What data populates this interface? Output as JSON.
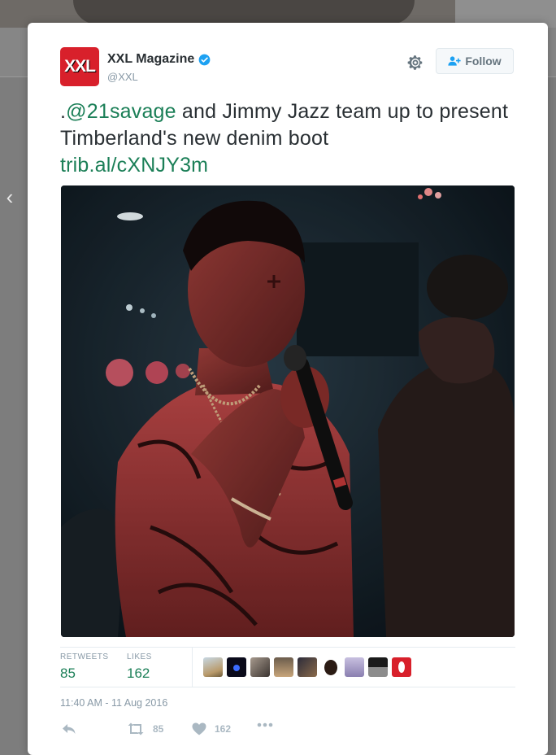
{
  "tweet": {
    "author_name": "XXL Magazine",
    "author_handle": "@XXL",
    "avatar_text": "XXL",
    "follow_label": "Follow",
    "text_prefix": ".",
    "mention": "@21savage",
    "text_body": " and Jimmy Jazz team up to present Timberland's new denim boot",
    "link": "trib.al/cXNJY3m",
    "retweets_label": "RETWEETS",
    "retweets_count": "85",
    "likes_label": "LIKES",
    "likes_count": "162",
    "timestamp": "11:40 AM - 11 Aug 2016",
    "action_retweet_count": "85",
    "action_like_count": "162"
  },
  "icons": {
    "verified": "verified-badge-icon",
    "settings": "gear-icon",
    "follow": "add-user-icon",
    "reply": "reply-icon",
    "retweet": "retweet-icon",
    "like": "heart-icon",
    "more": "more-icon",
    "nav": "chevron-left-icon"
  },
  "colors": {
    "link": "#1b7f57",
    "verified": "#1da1f2",
    "brand_red": "#d8202b"
  }
}
